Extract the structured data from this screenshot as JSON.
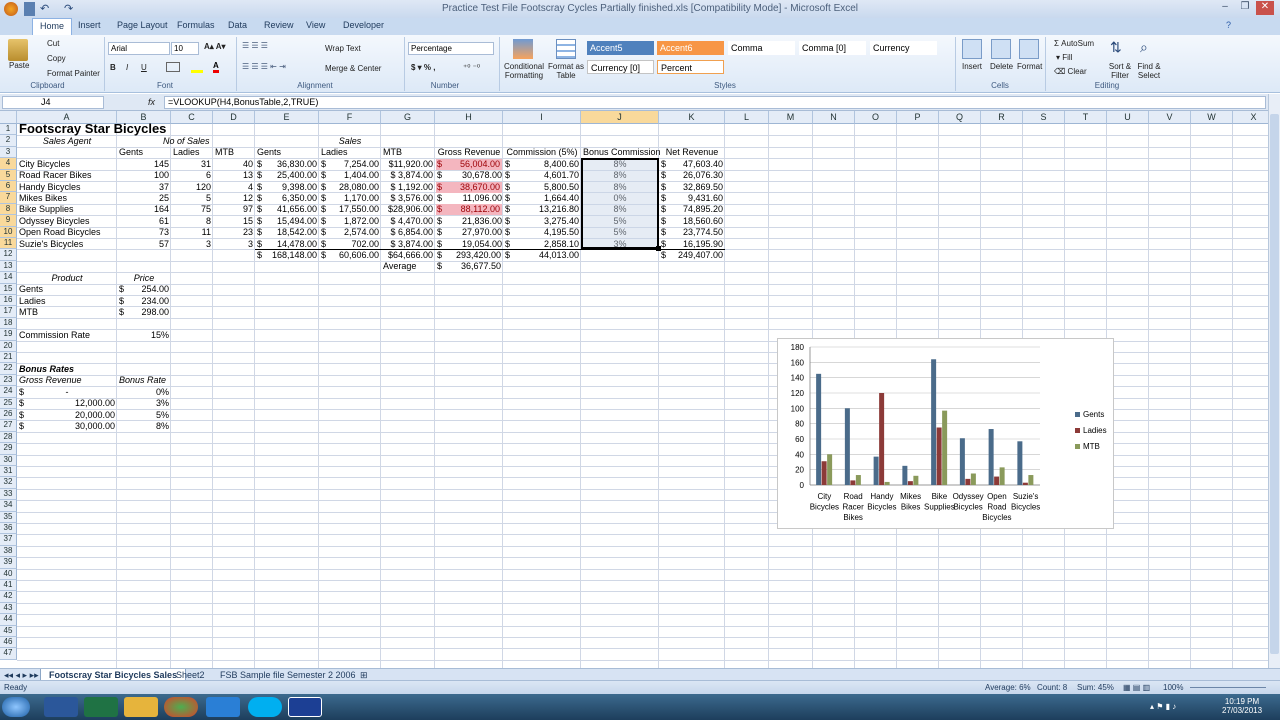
{
  "window": {
    "title": "Practice Test File Footscray Cycles Partially finished.xls [Compatibility Mode] - Microsoft Excel"
  },
  "tabs": [
    "Home",
    "Insert",
    "Page Layout",
    "Formulas",
    "Data",
    "Review",
    "View",
    "Developer"
  ],
  "ribbon": {
    "clipboard": {
      "paste": "Paste",
      "cut": "Cut",
      "copy": "Copy",
      "format_painter": "Format Painter",
      "label": "Clipboard"
    },
    "font": {
      "name": "Arial",
      "size": "10",
      "label": "Font"
    },
    "alignment": {
      "wrap": "Wrap Text",
      "merge": "Merge & Center",
      "label": "Alignment"
    },
    "number": {
      "format": "Percentage",
      "label": "Number"
    },
    "styles": {
      "conditional": "Conditional Formatting",
      "format_table": "Format as Table",
      "cells": [
        {
          "name": "Accent5",
          "bg": "#4f81bd",
          "fg": "#ffffff"
        },
        {
          "name": "Accent6",
          "bg": "#f79646",
          "fg": "#ffffff"
        },
        {
          "name": "Comma",
          "bg": "#ffffff",
          "fg": "#000000"
        },
        {
          "name": "Comma [0]",
          "bg": "#ffffff",
          "fg": "#000000"
        },
        {
          "name": "Currency",
          "bg": "#ffffff",
          "fg": "#000000"
        },
        {
          "name": "Currency [0]",
          "bg": "#ffffff",
          "fg": "#000000"
        },
        {
          "name": "Percent",
          "bg": "#ffffff",
          "fg": "#000000"
        }
      ],
      "label": "Styles"
    },
    "cells": {
      "insert": "Insert",
      "delete": "Delete",
      "format": "Format",
      "label": "Cells"
    },
    "editing": {
      "autosum": "AutoSum",
      "fill": "Fill",
      "clear": "Clear",
      "sort": "Sort & Filter",
      "find": "Find & Select",
      "label": "Editing"
    }
  },
  "formula_bar": {
    "name_box": "J4",
    "formula": "=VLOOKUP(H4,BonusTable,2,TRUE)",
    "fx": "fx"
  },
  "columns": [
    "A",
    "B",
    "C",
    "D",
    "E",
    "F",
    "G",
    "H",
    "I",
    "J",
    "K",
    "L",
    "M",
    "N",
    "O",
    "P",
    "Q",
    "R",
    "S",
    "T",
    "U",
    "V",
    "W",
    "X"
  ],
  "sheet": {
    "title": "Footscray Star Bicycles",
    "r2": {
      "sales_agent": "Sales Agent",
      "no_sales": "No of Sales",
      "sales": "Sales"
    },
    "r3": [
      "Gents",
      "Ladies",
      "MTB",
      "Gents",
      "Ladies",
      "MTB",
      "Gross Revenue",
      "Commission (5%)",
      "Bonus Commission",
      "Net Revenue"
    ],
    "agents": [
      {
        "name": "City Bicycles",
        "g": "145",
        "l": "31",
        "m": "40",
        "eg": "36,830.00",
        "el": "7,254.00",
        "em": "$11,920.00",
        "gr": "56,004.00",
        "co": "8,400.60",
        "bc": "8%",
        "nr": "47,603.40",
        "hl": true
      },
      {
        "name": "Road Racer Bikes",
        "g": "100",
        "l": "6",
        "m": "13",
        "eg": "25,400.00",
        "el": "1,404.00",
        "em": "$ 3,874.00",
        "gr": "30,678.00",
        "co": "4,601.70",
        "bc": "8%",
        "nr": "26,076.30",
        "hl": false
      },
      {
        "name": "Handy Bicycles",
        "g": "37",
        "l": "120",
        "m": "4",
        "eg": "9,398.00",
        "el": "28,080.00",
        "em": "$ 1,192.00",
        "gr": "38,670.00",
        "co": "5,800.50",
        "bc": "8%",
        "nr": "32,869.50",
        "hl": true
      },
      {
        "name": "Mikes Bikes",
        "g": "25",
        "l": "5",
        "m": "12",
        "eg": "6,350.00",
        "el": "1,170.00",
        "em": "$ 3,576.00",
        "gr": "11,096.00",
        "co": "1,664.40",
        "bc": "0%",
        "nr": "9,431.60",
        "hl": false
      },
      {
        "name": "Bike Supplies",
        "g": "164",
        "l": "75",
        "m": "97",
        "eg": "41,656.00",
        "el": "17,550.00",
        "em": "$28,906.00",
        "gr": "88,112.00",
        "co": "13,216.80",
        "bc": "8%",
        "nr": "74,895.20",
        "hl": true
      },
      {
        "name": "Odyssey Bicycles",
        "g": "61",
        "l": "8",
        "m": "15",
        "eg": "15,494.00",
        "el": "1,872.00",
        "em": "$ 4,470.00",
        "gr": "21,836.00",
        "co": "3,275.40",
        "bc": "5%",
        "nr": "18,560.60",
        "hl": false
      },
      {
        "name": "Open Road Bicycles",
        "g": "73",
        "l": "11",
        "m": "23",
        "eg": "18,542.00",
        "el": "2,574.00",
        "em": "$ 6,854.00",
        "gr": "27,970.00",
        "co": "4,195.50",
        "bc": "5%",
        "nr": "23,774.50",
        "hl": false
      },
      {
        "name": "Suzie's Bicycles",
        "g": "57",
        "l": "3",
        "m": "3",
        "eg": "14,478.00",
        "el": "702.00",
        "em": "$ 3,874.00",
        "gr": "19,054.00",
        "co": "2,858.10",
        "bc": "3%",
        "nr": "16,195.90",
        "hl": false
      }
    ],
    "totals": {
      "eg": "168,148.00",
      "el": "60,606.00",
      "em": "$64,666.00",
      "gr": "293,420.00",
      "co": "44,013.00",
      "nr": "249,407.00"
    },
    "average": {
      "label": "Average",
      "value": "36,677.50"
    },
    "products": {
      "h1": "Product",
      "h2": "Price",
      "rows": [
        [
          "Gents",
          "254.00"
        ],
        [
          "Ladies",
          "234.00"
        ],
        [
          "MTB",
          "298.00"
        ]
      ]
    },
    "commission": {
      "label": "Commission Rate",
      "value": "15%"
    },
    "bonus": {
      "title": "Bonus Rates",
      "h1": "Gross Revenue",
      "h2": "Bonus Rate",
      "rows": [
        [
          "-",
          "0%"
        ],
        [
          "12,000.00",
          "3%"
        ],
        [
          "20,000.00",
          "5%"
        ],
        [
          "30,000.00",
          "8%"
        ]
      ]
    },
    "currency": "$"
  },
  "chart_data": {
    "type": "bar",
    "categories": [
      "City Bicycles",
      "Road Racer Bikes",
      "Handy Bicycles",
      "Mikes Bikes",
      "Bike Supplies",
      "Odyssey Bicycles",
      "Open Road Bicycles",
      "Suzie's Bicycles"
    ],
    "category_lines": [
      [
        "City",
        "Bicycles"
      ],
      [
        "Road",
        "Racer",
        "Bikes"
      ],
      [
        "Handy",
        "Bicycles"
      ],
      [
        "Mikes",
        "Bikes"
      ],
      [
        "Bike",
        "Supplies"
      ],
      [
        "Odyssey",
        "Bicycles"
      ],
      [
        "Open",
        "Road",
        "Bicycles"
      ],
      [
        "Suzie's",
        "Bicycles"
      ]
    ],
    "series": [
      {
        "name": "Gents",
        "color": "#4a6b8a",
        "values": [
          145,
          100,
          37,
          25,
          164,
          61,
          73,
          57
        ]
      },
      {
        "name": "Ladies",
        "color": "#8c3a38",
        "values": [
          31,
          6,
          120,
          5,
          75,
          8,
          11,
          3
        ]
      },
      {
        "name": "MTB",
        "color": "#8a9a5b",
        "values": [
          40,
          13,
          4,
          12,
          97,
          15,
          23,
          13
        ]
      }
    ],
    "ylim": [
      0,
      180
    ],
    "yticks": [
      0,
      20,
      40,
      60,
      80,
      100,
      120,
      140,
      160,
      180
    ],
    "legend": "right",
    "grid": true
  },
  "sheet_tabs": [
    "Footscray Star Bicycles Sales",
    "Sheet2",
    "FSB Sample file Semester 2 2006"
  ],
  "status": {
    "ready": "Ready",
    "average": "Average: 6%",
    "count": "Count: 8",
    "sum": "Sum: 45%",
    "zoom": "100%"
  },
  "clock": {
    "time": "10:19 PM",
    "date": "27/03/2013"
  }
}
